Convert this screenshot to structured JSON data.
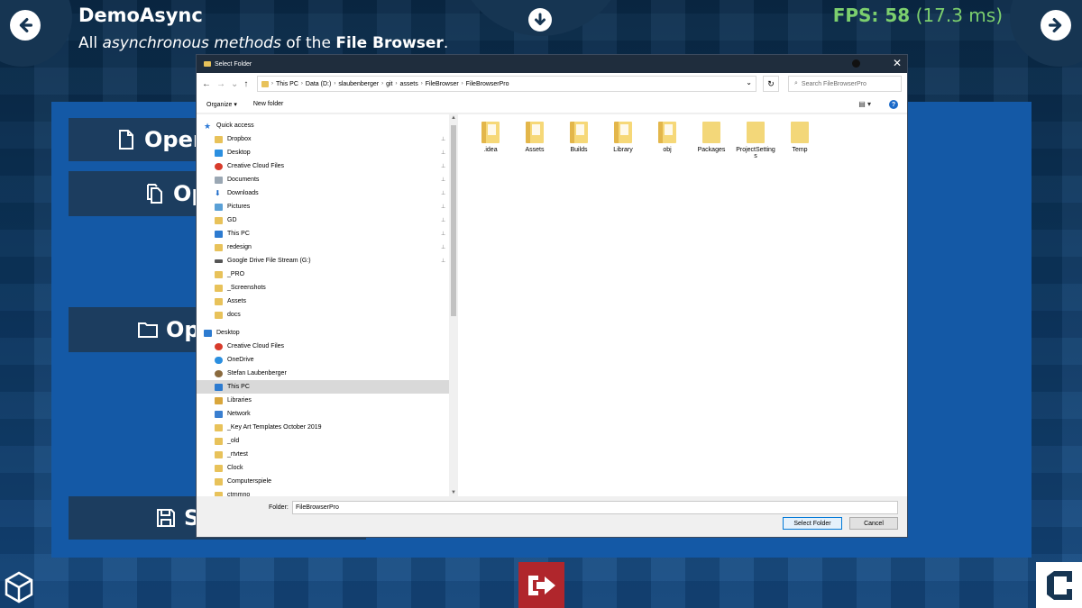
{
  "app": {
    "title": "DemoAsync",
    "subtitle_prefix": "All ",
    "subtitle_emph": "asynchronous methods",
    "subtitle_mid": " of the ",
    "subtitle_strong": "File Browser",
    "subtitle_suffix": ".",
    "fps_label": "FPS: 58",
    "fps_ms": "(17.3 ms)"
  },
  "demo_buttons": {
    "open_file": "Open",
    "open_files": "Op",
    "open_folder": "Op",
    "save": "S"
  },
  "colors": {
    "panel": "#1459a6",
    "button": "#1c3d5f",
    "fps": "#7ccf6e",
    "exit": "#b0262c"
  },
  "icons": {
    "back": "arrow-left-circle",
    "download": "arrow-down-circle",
    "next": "arrow-right-circle",
    "exit": "sign-out",
    "unity": "unity-logo",
    "brand": "brand-logo"
  },
  "dialog": {
    "title": "Select Folder",
    "close": "✕",
    "breadcrumb": [
      "This PC",
      "Data (D:)",
      "slaubenberger",
      "git",
      "assets",
      "FileBrowser",
      "FileBrowserPro"
    ],
    "search_placeholder": "Search FileBrowserPro",
    "organize": "Organize ▾",
    "new_folder": "New folder",
    "help": "?",
    "nav_items": [
      {
        "label": "Quick access",
        "icon": "star"
      },
      {
        "label": "Dropbox",
        "icon": "folder",
        "pinned": true
      },
      {
        "label": "Desktop",
        "icon": "blue",
        "pinned": true
      },
      {
        "label": "Creative Cloud Files",
        "icon": "red",
        "pinned": true
      },
      {
        "label": "Documents",
        "icon": "doc",
        "pinned": true
      },
      {
        "label": "Downloads",
        "icon": "down",
        "pinned": true
      },
      {
        "label": "Pictures",
        "icon": "pic",
        "pinned": true
      },
      {
        "label": "GD",
        "icon": "folder",
        "pinned": true
      },
      {
        "label": "This PC",
        "icon": "pc",
        "pinned": true
      },
      {
        "label": "redesign",
        "icon": "folder",
        "pinned": true
      },
      {
        "label": "Google Drive File Stream (G:)",
        "icon": "drive",
        "pinned": true
      },
      {
        "label": "_PRO",
        "icon": "folder"
      },
      {
        "label": "_Screenshots",
        "icon": "folder"
      },
      {
        "label": "Assets",
        "icon": "folder"
      },
      {
        "label": "docs",
        "icon": "folder"
      },
      {
        "label": "Desktop",
        "icon": "pc"
      },
      {
        "label": "Creative Cloud Files",
        "icon": "red"
      },
      {
        "label": "OneDrive",
        "icon": "cloud"
      },
      {
        "label": "Stefan Laubenberger",
        "icon": "user"
      },
      {
        "label": "This PC",
        "icon": "pc",
        "selected": true
      },
      {
        "label": "Libraries",
        "icon": "lib"
      },
      {
        "label": "Network",
        "icon": "net"
      },
      {
        "label": "_Key Art Templates October 2019",
        "icon": "folder"
      },
      {
        "label": "_old",
        "icon": "folder"
      },
      {
        "label": "_rtvtest",
        "icon": "folder"
      },
      {
        "label": "Clock",
        "icon": "folder"
      },
      {
        "label": "Computerspiele",
        "icon": "folder"
      },
      {
        "label": "ctrnmno",
        "icon": "folder"
      }
    ],
    "files": [
      {
        "label": ".idea"
      },
      {
        "label": "Assets"
      },
      {
        "label": "Builds"
      },
      {
        "label": "Library"
      },
      {
        "label": "obj"
      },
      {
        "label": "Packages"
      },
      {
        "label": "ProjectSettings"
      },
      {
        "label": "Temp"
      }
    ],
    "folder_label": "Folder:",
    "folder_value": "FileBrowserPro",
    "select_button": "Select Folder",
    "cancel_button": "Cancel"
  }
}
